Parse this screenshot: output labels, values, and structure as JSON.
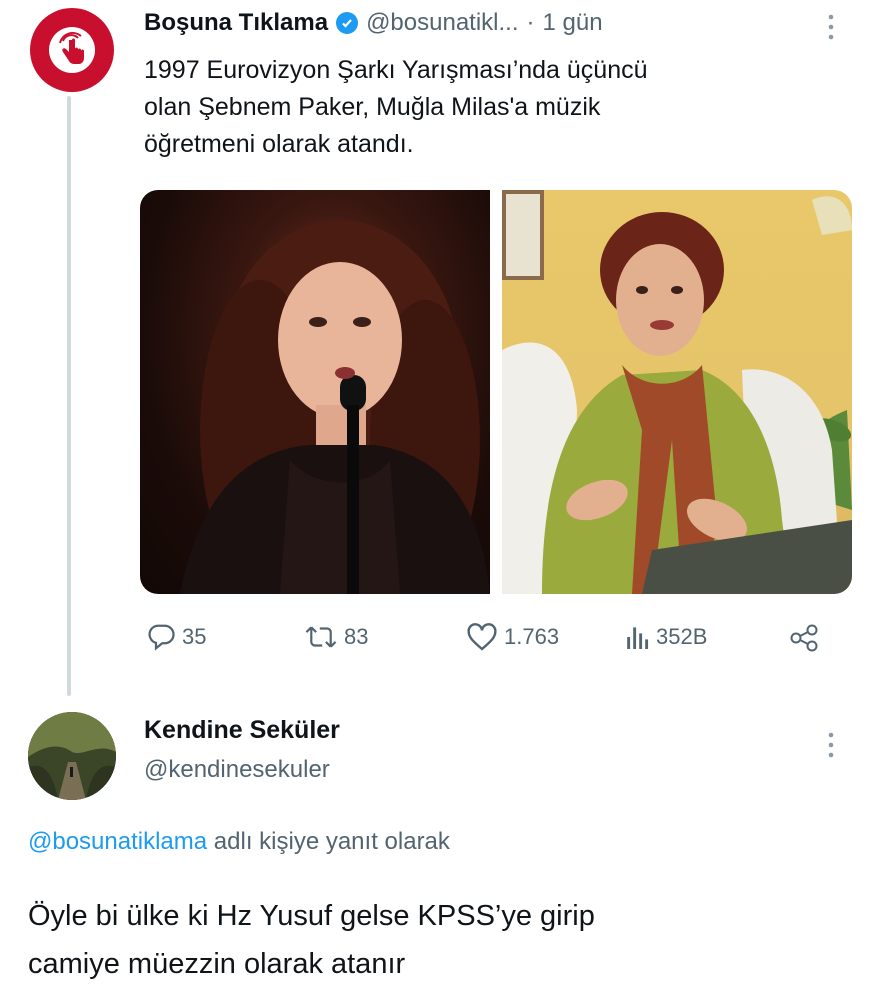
{
  "tweet": {
    "display_name": "Boşuna Tıklama",
    "handle": "@bosunatikl...",
    "separator": "·",
    "time": "1 gün",
    "text_lines": [
      "1997 Eurovizyon Şarkı Yarışması’nda üçüncü",
      "olan Şebnem Paker, Muğla Milas'a müzik",
      "öğretmeni olarak atandı."
    ],
    "stats": {
      "replies": "35",
      "retweets": "83",
      "likes": "1.763",
      "views": "352B"
    }
  },
  "reply": {
    "display_name": "Kendine Seküler",
    "handle": "@kendinesekuler",
    "reply_to_mention": "@bosunatiklama",
    "reply_to_suffix": " adlı kişiye yanıt olarak",
    "text_lines": [
      "Öyle bi ülke ki Hz Yusuf gelse KPSS’ye girip",
      "camiye müezzin olarak atanır"
    ]
  },
  "colors": {
    "brand_red": "#c8102e",
    "verified_blue": "#1d9bf0",
    "link_blue": "#1d9bf0",
    "secondary_text": "#536471"
  },
  "icons": [
    "pointer-hand-icon",
    "verified-badge-icon",
    "more-options-icon",
    "reply-icon",
    "retweet-icon",
    "like-icon",
    "views-icon",
    "share-icon"
  ]
}
